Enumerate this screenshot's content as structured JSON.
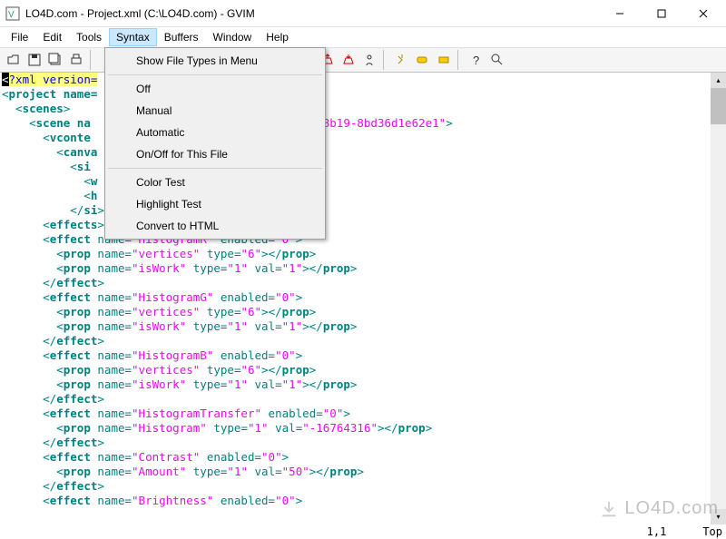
{
  "window": {
    "title": "LO4D.com - Project.xml (C:\\LO4D.com) - GVIM"
  },
  "menu": {
    "items": [
      "File",
      "Edit",
      "Tools",
      "Syntax",
      "Buffers",
      "Window",
      "Help"
    ],
    "open_index": 3
  },
  "dropdown": {
    "groups": [
      [
        "Show File Types in Menu"
      ],
      [
        "Off",
        "Manual",
        "Automatic",
        "On/Off for This File"
      ],
      [
        "Color Test",
        "Highlight Test",
        "Convert to HTML"
      ]
    ]
  },
  "status": {
    "position": "1,1",
    "scroll": "Top"
  },
  "watermark": "LO4D.com",
  "editor_visible_uuid_fragment": "13c-4ca3-8b19-8bd36d1e62e1",
  "code": {
    "xml_decl_prefix": "?xml version=",
    "project_prefix": "project name=",
    "scenes_open": "scenes",
    "scene_prefix": "scene na",
    "vcontext": "vconte",
    "canvas": "canva",
    "siz": "si",
    "w": "w",
    "h": "h",
    "siz_close": "si",
    "effects": "effects",
    "effect_open": "effect",
    "effect_close": "effect",
    "prop": "prop",
    "name_attr": "name",
    "enabled_attr": "enabled",
    "type_attr": "type",
    "val_attr": "val",
    "names": {
      "histR": "HistogramR",
      "histG": "HistogramG",
      "histB": "HistogramB",
      "histT": "HistogramTransfer",
      "hist": "Histogram",
      "contrast": "Contrast",
      "brightness": "Brightness",
      "vertices": "vertices",
      "isWork": "isWork",
      "amount": "Amount"
    },
    "vals": {
      "zero": "0",
      "one": "1",
      "six": "6",
      "neg": "-16764316",
      "fifty": "50"
    }
  }
}
